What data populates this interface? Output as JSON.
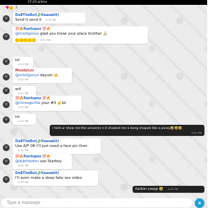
{
  "status_bar": {
    "online_text": "27:43 online"
  },
  "reactions": {
    "count": "2"
  },
  "messages": [
    {
      "sender": "DuBTheBoi(💸Kaasakit)",
      "text": "Send it send it",
      "time": "4:31 PM"
    },
    {
      "sender": "💯🔥Runtupez 💯🔥",
      "mention": "@mistigenus",
      "text": " glad you know your place brother 🙏",
      "time": "4:31 PM"
    },
    {
      "text": "lol",
      "time": "4:31 PM"
    },
    {
      "sender": "MoodzLuv",
      "mention": "@mistigenus",
      "text": " dayum 🤟",
      "time": "4:31 PM"
    },
    {
      "text": "wtf",
      "time": "4:31 PM"
    },
    {
      "sender": "💯🔥Runtupez 💯🔥",
      "mention": "@chrosgorilla",
      "text": " your #3 🤘lol",
      "time": "4:31 PM"
    },
    {
      "text": "lol",
      "time": "4:31 PM"
    },
    {
      "text": "I told ur show me the universe n it showed me a bong shaped like a pussy🤣🤣🤣",
      "time": "4:31 PM"
    },
    {
      "sender": "DuBTheBoi(💸Kaasakit)",
      "text": "Use A/F OK I'll just need a face pic then.",
      "time": "4:31 PM"
    },
    {
      "sender": "💯🔥Runtupez 💯🔥",
      "mention": "@dubthedon",
      "text": " use Starboy",
      "time": "4:31 PM"
    },
    {
      "sender": "DuBTheBoi(💸Kaasakit)",
      "text": "I'll even make a deep fake sex video",
      "time": "4:31 PM"
    },
    {
      "text": "fuckin creep 🤣",
      "time": "4:31 PM"
    }
  ],
  "input": {
    "placeholder": "Type a message"
  },
  "colors": {
    "accent": "#1f67c8",
    "send": "#1aa0d8",
    "own_bubble": "#222222"
  }
}
